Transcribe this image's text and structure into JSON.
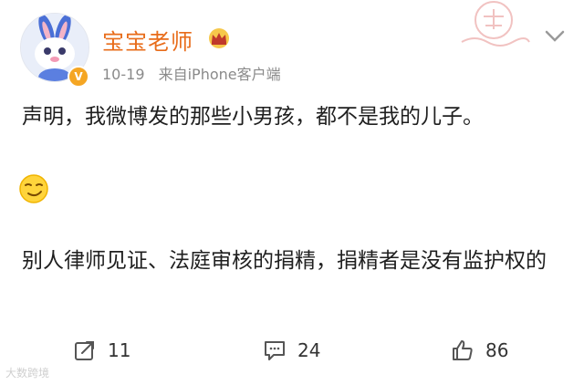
{
  "post": {
    "author": "宝宝老师",
    "date": "10-19",
    "source": "来自iPhone客户端",
    "paragraph1": "声明，我微博发的那些小男孩，都不是我的儿子。",
    "paragraph2": "别人律师见证、法庭审核的捐精，捐精者是没有监护权的",
    "emoji": "smirk-face-emoji"
  },
  "actions": {
    "reposts": "11",
    "comments": "24",
    "likes": "86"
  },
  "watermark": "大数跨境",
  "colors": {
    "username": "#e86c1a",
    "verified": "#f5a623"
  }
}
